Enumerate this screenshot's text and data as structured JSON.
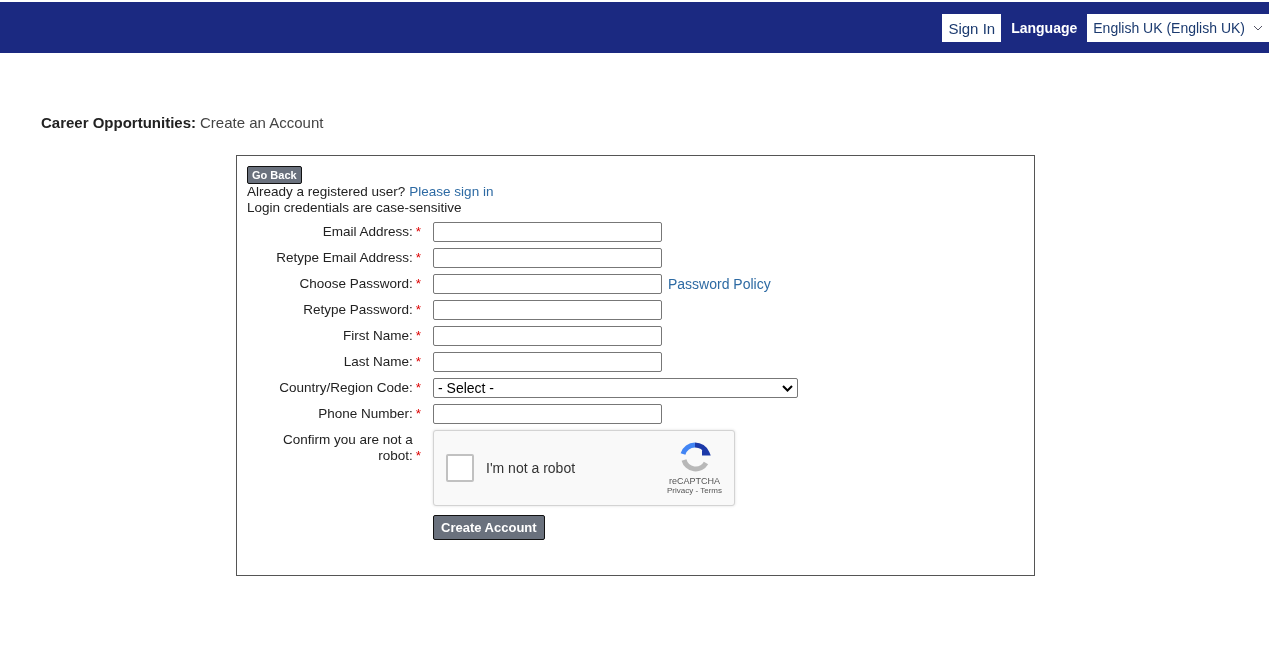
{
  "header": {
    "sign_in": "Sign In",
    "language_label": "Language",
    "language_value": "English UK (English UK)"
  },
  "page_title": {
    "section": "Career Opportunities:",
    "title": "Create an Account"
  },
  "form": {
    "go_back": "Go Back",
    "registered_text": "Already a registered user?",
    "sign_in_link": "Please sign in",
    "note": "Login credentials are case-sensitive",
    "fields": [
      {
        "kind": "text",
        "label": "Email Address:",
        "required": "*"
      },
      {
        "kind": "text",
        "label": "Retype Email Address:",
        "required": "*"
      },
      {
        "kind": "password",
        "label": "Choose Password:",
        "required": "*",
        "link": "Password Policy"
      },
      {
        "kind": "password",
        "label": "Retype Password:",
        "required": "*"
      },
      {
        "kind": "text",
        "label": "First Name:",
        "required": "*"
      },
      {
        "kind": "text",
        "label": "Last Name:",
        "required": "*"
      },
      {
        "kind": "select",
        "label": "Country/Region Code:",
        "required": "*",
        "value": "- Select -"
      },
      {
        "kind": "text",
        "label": "Phone Number:",
        "required": "*"
      },
      {
        "kind": "captcha",
        "label": "Confirm you are not a robot:",
        "required": "*",
        "checkbox_label": "I'm not a robot",
        "checked": false,
        "brand": "reCAPTCHA",
        "links": "Privacy - Terms"
      }
    ],
    "submit": "Create Account"
  }
}
